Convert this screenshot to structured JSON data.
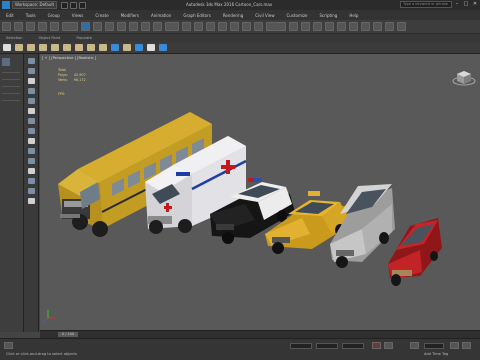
{
  "window": {
    "title": "Autodesk 3ds Max 2016    Cartoon_Cars.max",
    "workspace": "Workspace: Default",
    "search_placeholder": "Type a keyword or phrase"
  },
  "menu": {
    "items": [
      "Edit",
      "Tools",
      "Group",
      "Views",
      "Create",
      "Modifiers",
      "Animation",
      "Graph Editors",
      "Rendering",
      "Civil View",
      "Customize",
      "Scripting",
      "Help"
    ]
  },
  "ribbon": {
    "tabs": [
      "Selection",
      "Object Paint",
      "Populate"
    ]
  },
  "viewport": {
    "label": "[ + ] [Perspective ] [Realistic ]",
    "stats": {
      "header": "Total",
      "polys_label": "Polys:",
      "polys_value": "42,907",
      "verts_label": "Verts:",
      "verts_value": "96,172",
      "fps_label": "FPS:"
    }
  },
  "timeline": {
    "slider_label": "0 / 100"
  },
  "status": {
    "prompt": "Click or click-and-drag to select objects",
    "add_time_tag": "Add Time Tag"
  },
  "colors": {
    "bus": "#c9a227",
    "ambulance": "#e8e8ea",
    "police": "#1c1c1c",
    "taxi": "#e4b531",
    "suv": "#b8b8b8",
    "red_car": "#b21f22",
    "accent": "#2e6fa7"
  }
}
